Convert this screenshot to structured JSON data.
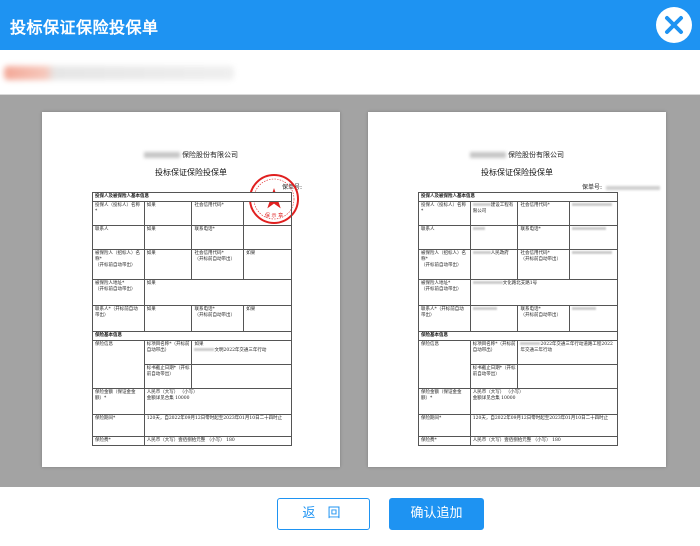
{
  "window": {
    "title": "投标保证保险投保单",
    "close_icon": "close-icon"
  },
  "documents": [
    {
      "company_suffix": "保险股份有限公司",
      "title": "投标保证保险投保单",
      "policy_no_label": "保单号:",
      "stamp_text": "保 示 章",
      "rows": {
        "section1": "投保人及被保险人基本信息",
        "applicant_name": "投保人（投标人）名称*",
        "applicant_value": "如果",
        "credit_code": "社会信用代码*",
        "contact": "联系人",
        "contact_value": "如果",
        "phone": "联系电话*",
        "insured_name": "被保险人（招标人）名称*",
        "insured_note": "（开标前自动带出）",
        "insured_value": "如果",
        "insured_credit": "社会信用代码*",
        "insured_credit_note": "（开标前自动带出）",
        "insured_credit_value": "如果",
        "insured_address": "被保险人地址*",
        "insured_address_note": "（开标前自动带出）",
        "insured_address_value": "如果",
        "insured_contact": "联系人*（开标前自动带出）",
        "insured_contact_value": "如果",
        "insured_phone": "联系电话*",
        "insured_phone_note": "（开标前自动带出）",
        "insured_phone_value": "如果",
        "section2": "保险基本信息",
        "project_info": "保险信息",
        "project_name": "标项目名称*（开标前自动带出）",
        "project_name_value": "如果",
        "project_name_suffix": "文明2022年交通三年行动",
        "bid_date": "标书截止日期*（开标前自动带出）",
        "coverage": "保险金额（保证金金额）*",
        "rmb_big": "人民币（大写）",
        "rmb_small": "（小写）",
        "amount_label": "金额详见合集",
        "amount_value": "10000",
        "period": "保险期间*",
        "period_value": "120天，自2022年09月12日零时起至2023年01月10日二十四时止",
        "premium": "保险费*",
        "premium_value": "人民币（大写）壹佰捌拾元整",
        "premium_small": "（小写）",
        "premium_amount": "180"
      }
    },
    {
      "company_suffix": "保险股份有限公司",
      "title": "投标保证保险投保单",
      "policy_no_label": "保单号:",
      "rows": {
        "section1": "投保人及被保险人基本信息",
        "applicant_name": "投保人（投标人）名称*",
        "applicant_value_suffix": "建设工程有限公司",
        "credit_code": "社会信用代码*",
        "contact": "联系人",
        "phone": "联系电话*",
        "insured_name": "被保险人（招标人）名称*",
        "insured_note": "（开标前自动带出）",
        "insured_value_suffix": "人民政府",
        "insured_credit": "社会信用代码*",
        "insured_credit_note": "（开标前自动带出）",
        "insured_address": "被保险人地址*",
        "insured_address_note": "（开标前自动带出）",
        "insured_address_value_suffix": "文化路北支路1号",
        "insured_contact": "联系人*（开标前自动带出）",
        "insured_phone": "联系电话*",
        "insured_phone_note": "（开标前自动带出）",
        "section2": "保险基本信息",
        "project_info": "保险信息",
        "project_name": "标项目名称*（开标前自动带出）",
        "project_name_suffix": "2022年交通三年行动道路工程2022年交通三年行动",
        "bid_date": "标书截止日期*（开标前自动带出）",
        "coverage": "保险金额（保证金金额）*",
        "rmb_big": "人民币（大写）",
        "rmb_small": "（小写）",
        "amount_label": "金额详见合集",
        "amount_value": "10000",
        "period": "保险期间*",
        "period_value": "120天，自2022年09月12日零时起至2023年01月10日二十四时止",
        "premium": "保险费*",
        "premium_value": "人民币（大写）壹佰捌拾元整",
        "premium_small": "（小写）",
        "premium_amount": "180"
      }
    }
  ],
  "footer": {
    "back_label": "返 回",
    "confirm_label": "确认追加"
  },
  "colors": {
    "accent": "#1e93f2",
    "preview_bg": "#a3a3a3",
    "stamp_red": "#e02020"
  }
}
